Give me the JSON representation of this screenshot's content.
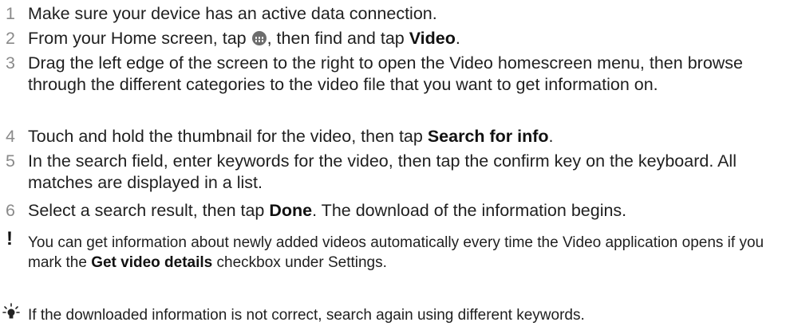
{
  "steps": [
    {
      "num": "1",
      "parts": [
        "Make sure your device has an active data connection."
      ]
    },
    {
      "num": "2",
      "p1": "From your Home screen, tap ",
      "icon": "apps-grid-icon",
      "p2": ", then find and tap ",
      "bold": "Video",
      "p3": "."
    },
    {
      "num": "3",
      "text": "Drag the left edge of the screen to the right to open the Video homescreen menu, then browse through the different categories to the video file that you want to get information on."
    },
    {
      "num": "4",
      "p1": "Touch and hold the thumbnail for the video, then tap ",
      "bold": "Search for info",
      "p2": "."
    },
    {
      "num": "5",
      "text": "In the search field, enter keywords for the video, then tap the confirm key on the keyboard. All matches are displayed in a list."
    },
    {
      "num": "6",
      "p1": "Select a search result, then tap ",
      "bold": "Done",
      "p2": ". The download of the information begins."
    }
  ],
  "note": {
    "icon": "exclamation-icon",
    "symbol": "!",
    "p1": "You can get information about newly added videos automatically every time the Video application opens if you mark the ",
    "bold": "Get video details",
    "p2": " checkbox under Settings."
  },
  "tip": {
    "icon": "lightbulb-icon",
    "text": "If the downloaded information is not correct, search again using different keywords."
  }
}
